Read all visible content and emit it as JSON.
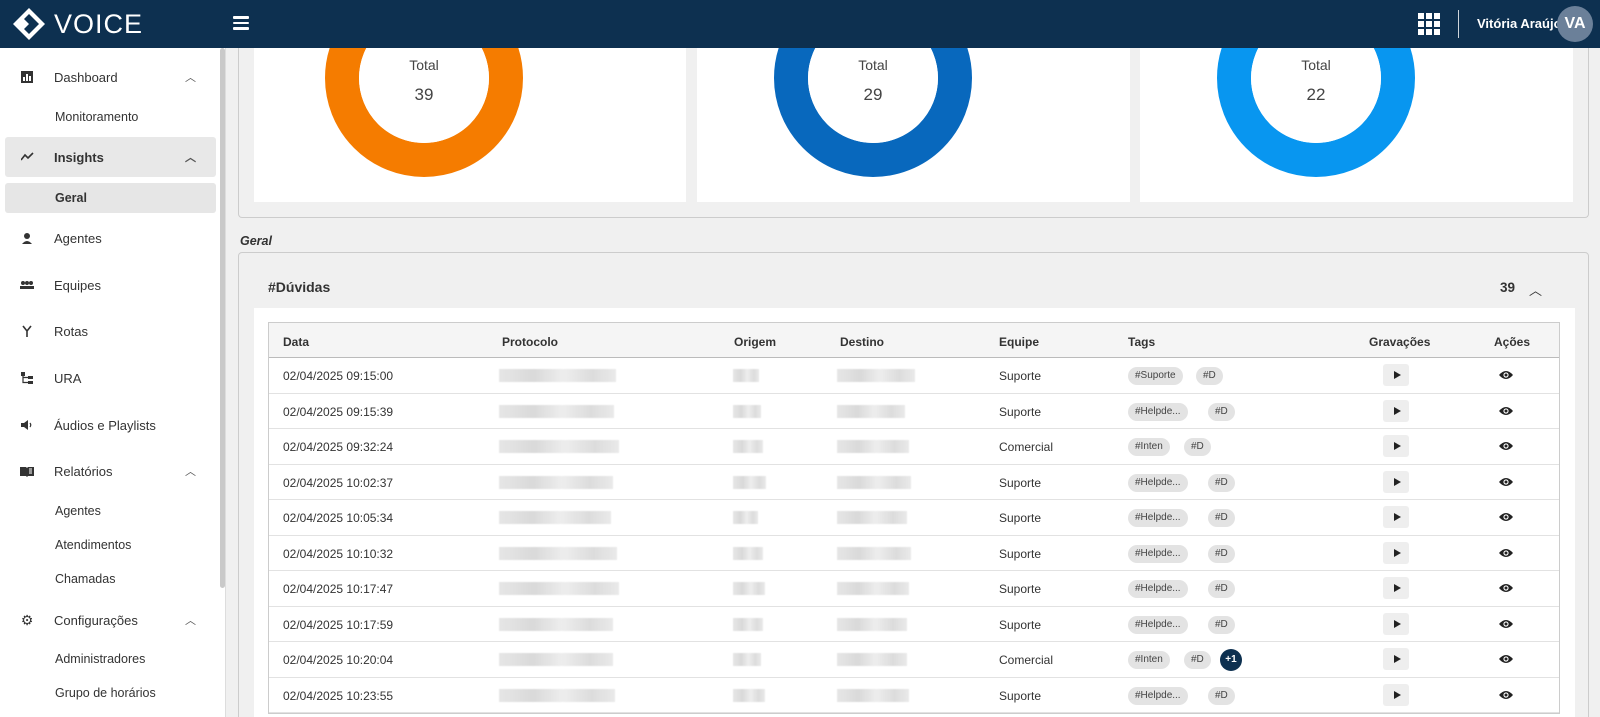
{
  "app": {
    "logo_text": "VOICE"
  },
  "header": {
    "user_name": "Vitória Araújo",
    "avatar_initials": "VA"
  },
  "sidebar": {
    "items": [
      {
        "label": "Dashboard",
        "icon": "bar-chart-icon",
        "expanded": true
      },
      {
        "label": "Monitoramento",
        "sub": true
      },
      {
        "label": "Insights",
        "icon": "trend-line-icon",
        "expanded": true,
        "active": true
      },
      {
        "label": "Geral",
        "sub": true,
        "active": true
      },
      {
        "label": "Agentes",
        "icon": "agent-icon"
      },
      {
        "label": "Equipes",
        "icon": "team-icon"
      },
      {
        "label": "Rotas",
        "icon": "route-icon"
      },
      {
        "label": "URA",
        "icon": "ura-icon"
      },
      {
        "label": "Áudios e Playlists",
        "icon": "speaker-icon"
      },
      {
        "label": "Relatórios",
        "icon": "report-book-icon",
        "expanded": true
      },
      {
        "label": "Agentes",
        "sub": true
      },
      {
        "label": "Atendimentos",
        "sub": true
      },
      {
        "label": "Chamadas",
        "sub": true
      },
      {
        "label": "Configurações",
        "icon": "gear-icon",
        "expanded": true
      },
      {
        "label": "Administradores",
        "sub": true
      },
      {
        "label": "Grupo de horários",
        "sub": true
      }
    ]
  },
  "summary": {
    "cards": [
      {
        "label": "Total",
        "value": "39",
        "color": "#f57c00"
      },
      {
        "label": "Total",
        "value": "29",
        "color": "#0868bd"
      },
      {
        "label": "Total",
        "value": "22",
        "color": "#0896f0"
      }
    ]
  },
  "section": {
    "title": "Geral"
  },
  "group": {
    "name": "#Dúvidas",
    "count": "39"
  },
  "table": {
    "columns": [
      "Data",
      "Protocolo",
      "Origem",
      "Destino",
      "Equipe",
      "Tags",
      "Gravações",
      "Ações"
    ],
    "rows": [
      {
        "data": "02/04/2025 09:15:00",
        "equipe": "Suporte",
        "tags": [
          "#Suporte",
          "#D"
        ]
      },
      {
        "data": "02/04/2025 09:15:39",
        "equipe": "Suporte",
        "tags": [
          "#Helpde...",
          "#D"
        ]
      },
      {
        "data": "02/04/2025 09:32:24",
        "equipe": "Comercial",
        "tags": [
          "#Inten",
          "#D"
        ]
      },
      {
        "data": "02/04/2025 10:02:37",
        "equipe": "Suporte",
        "tags": [
          "#Helpde...",
          "#D"
        ]
      },
      {
        "data": "02/04/2025 10:05:34",
        "equipe": "Suporte",
        "tags": [
          "#Helpde...",
          "#D"
        ]
      },
      {
        "data": "02/04/2025 10:10:32",
        "equipe": "Suporte",
        "tags": [
          "#Helpde...",
          "#D"
        ]
      },
      {
        "data": "02/04/2025 10:17:47",
        "equipe": "Suporte",
        "tags": [
          "#Helpde...",
          "#D"
        ]
      },
      {
        "data": "02/04/2025 10:17:59",
        "equipe": "Suporte",
        "tags": [
          "#Helpde...",
          "#D"
        ]
      },
      {
        "data": "02/04/2025 10:20:04",
        "equipe": "Comercial",
        "tags": [
          "#Inten",
          "#D"
        ],
        "more": "+1"
      },
      {
        "data": "02/04/2025 10:23:55",
        "equipe": "Suporte",
        "tags": [
          "#Helpde...",
          "#D"
        ]
      }
    ]
  }
}
